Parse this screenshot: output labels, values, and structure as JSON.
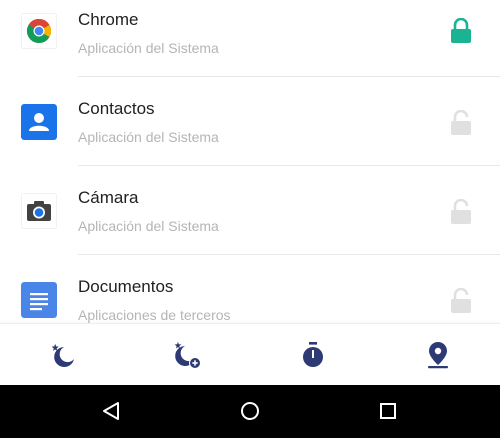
{
  "colors": {
    "accent": "#1ab394",
    "nav_icon": "#2d3a73",
    "unlocked": "#e0e0e0",
    "subtitle": "#b5b5b5"
  },
  "apps": [
    {
      "name": "Chrome",
      "subtitle": "Aplicación del Sistema",
      "icon": "chrome-icon",
      "locked": true
    },
    {
      "name": "Contactos",
      "subtitle": "Aplicación del Sistema",
      "icon": "contacts-icon",
      "locked": false
    },
    {
      "name": "Cámara",
      "subtitle": "Aplicación del Sistema",
      "icon": "camera-icon",
      "locked": false
    },
    {
      "name": "Documentos",
      "subtitle": "Aplicaciones de terceros",
      "icon": "docs-icon",
      "locked": false
    }
  ],
  "bottom_nav": [
    {
      "icon": "night-mode-icon"
    },
    {
      "icon": "add-night-mode-icon"
    },
    {
      "icon": "timer-icon"
    },
    {
      "icon": "location-pin-icon"
    }
  ],
  "system_nav": [
    {
      "icon": "back-icon"
    },
    {
      "icon": "home-icon"
    },
    {
      "icon": "recents-icon"
    }
  ]
}
